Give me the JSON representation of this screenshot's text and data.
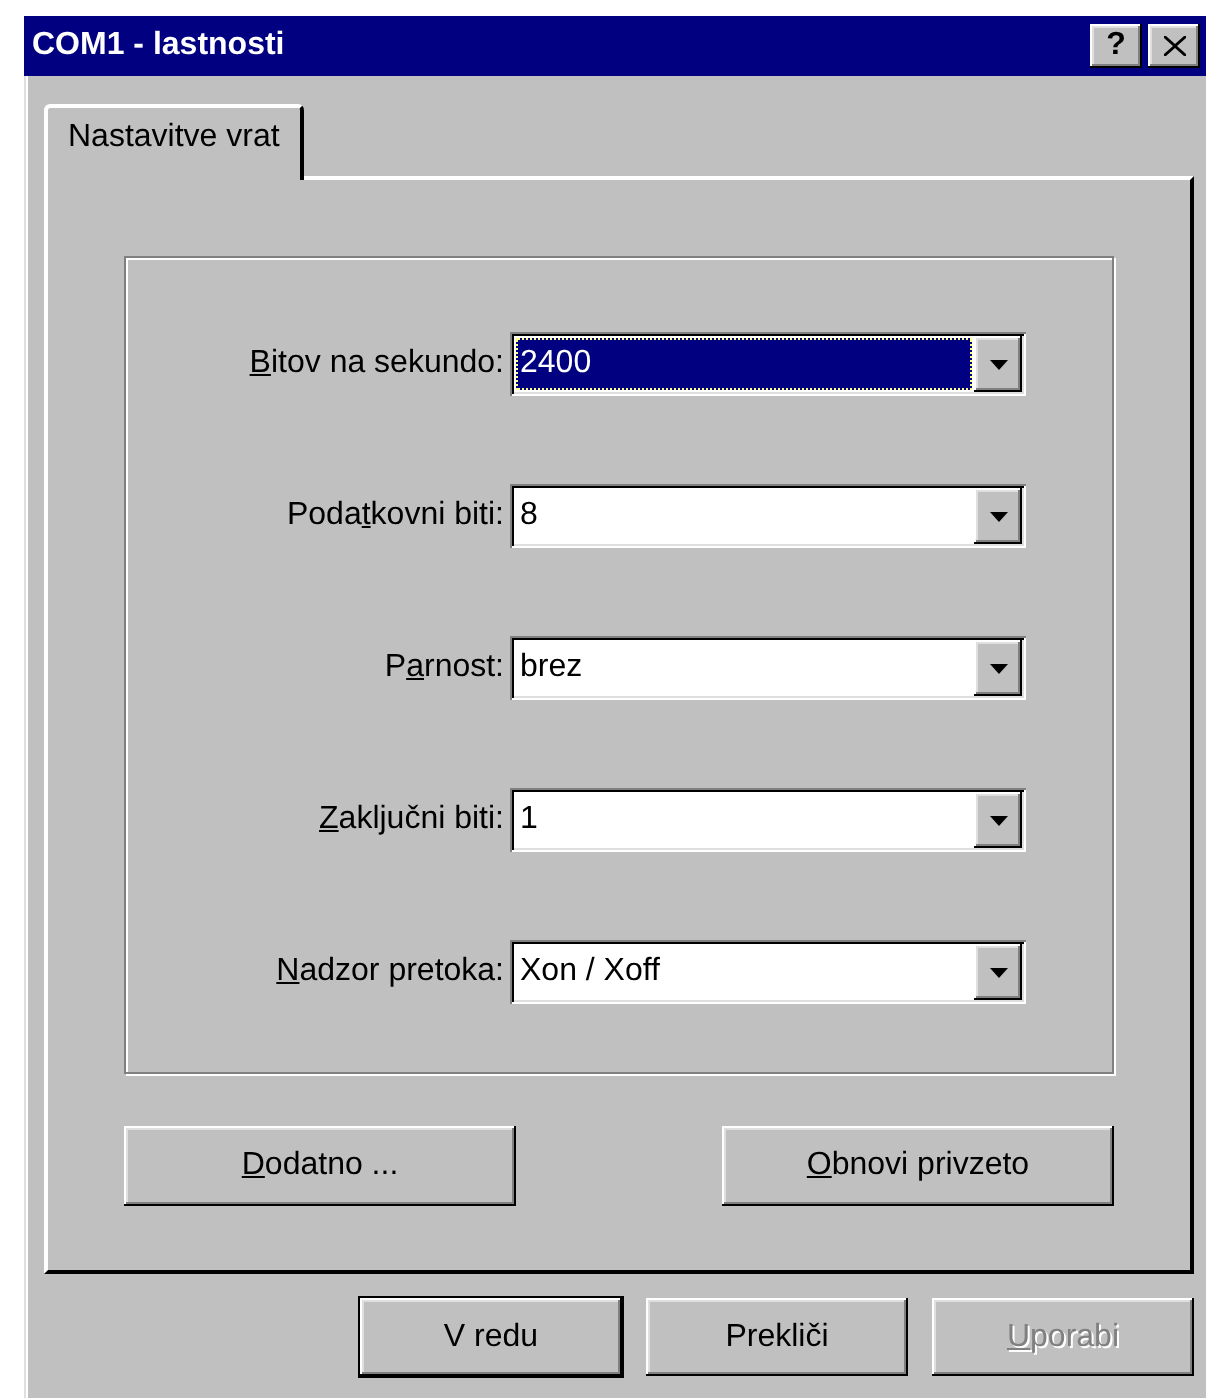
{
  "window": {
    "title": "COM1 - lastnosti",
    "help_button": "?"
  },
  "tabs": [
    {
      "label": "Nastavitve vrat",
      "selected": true
    }
  ],
  "fields": [
    {
      "label_parts": [
        {
          "text": "B",
          "underlined": true
        },
        {
          "text": "itov na sekundo:",
          "underlined": false
        }
      ],
      "value": "2400",
      "focused": true
    },
    {
      "label_parts": [
        {
          "text": "Poda",
          "underlined": false
        },
        {
          "text": "t",
          "underlined": true
        },
        {
          "text": "kovni biti:",
          "underlined": false
        }
      ],
      "value": "8",
      "focused": false
    },
    {
      "label_parts": [
        {
          "text": "P",
          "underlined": false
        },
        {
          "text": "a",
          "underlined": true
        },
        {
          "text": "rnost:",
          "underlined": false
        }
      ],
      "value": "brez",
      "focused": false
    },
    {
      "label_parts": [
        {
          "text": "Z",
          "underlined": true
        },
        {
          "text": "aključni biti:",
          "underlined": false
        }
      ],
      "value": "1",
      "focused": false
    },
    {
      "label_parts": [
        {
          "text": "N",
          "underlined": true
        },
        {
          "text": "adzor pretoka:",
          "underlined": false
        }
      ],
      "value": "Xon / Xoff",
      "focused": false
    }
  ],
  "buttons": [
    {
      "label_parts": [
        {
          "text": "D",
          "underlined": true
        },
        {
          "text": "odatno ...",
          "underlined": false
        }
      ]
    },
    {
      "label_parts": [
        {
          "text": "O",
          "underlined": true
        },
        {
          "text": "bnovi privzeto",
          "underlined": false
        }
      ]
    }
  ],
  "dialog_buttons": [
    {
      "label_parts": [
        {
          "text": "V redu",
          "underlined": false
        }
      ],
      "default": true,
      "disabled": false
    },
    {
      "label_parts": [
        {
          "text": "Prekliči",
          "underlined": false
        }
      ],
      "default": false,
      "disabled": false
    },
    {
      "label_parts": [
        {
          "text": "U",
          "underlined": true
        },
        {
          "text": "porabi",
          "underlined": false
        }
      ],
      "default": false,
      "disabled": true
    }
  ]
}
